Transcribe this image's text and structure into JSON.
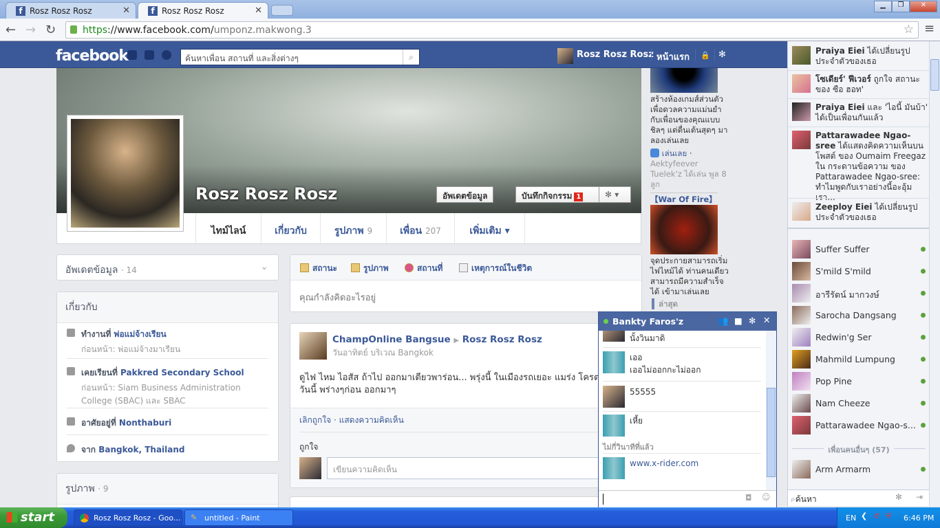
{
  "browser": {
    "tabs": [
      {
        "title": "Rosz Rosz Rosz"
      },
      {
        "title": "Rosz Rosz Rosz"
      }
    ],
    "url_scheme": "https",
    "url_host": "://www.facebook.com/",
    "url_path": "umponz.makwong.3"
  },
  "fb": {
    "logo": "facebook",
    "search_placeholder": "ค้นหาเพื่อน สถานที่ และสิ่งต่างๆ",
    "user_name": "Rosz Rosz Rosz",
    "home": "หน้าแรก"
  },
  "profile": {
    "name": "Rosz Rosz Rosz",
    "update_info": "อัพเดตข้อมูล",
    "activity_log": "บันทึกกิจกรรม",
    "activity_count": "1",
    "tabs": [
      {
        "label": "ไทม์ไลน์",
        "count": ""
      },
      {
        "label": "เกี่ยวกับ",
        "count": ""
      },
      {
        "label": "รูปภาพ",
        "count": "9"
      },
      {
        "label": "เพื่อน",
        "count": "207"
      },
      {
        "label": "เพิ่มเติม ▾",
        "count": ""
      }
    ]
  },
  "left": {
    "updates_label": "อัพเดตข้อมูล",
    "updates_count": "· 14",
    "about_title": "เกี่ยวกับ",
    "about": [
      {
        "prefix": "ทำงานที่ ",
        "link": "พ่อแม่จ้างเรียน",
        "sub": "ก่อนหน้า: พ่อแม่จ้างมาเรียน"
      },
      {
        "prefix": "เคยเรียนที่ ",
        "link": "Pakkred Secondary School",
        "sub": "ก่อนหน้า: Siam Business Administration College (SBAC) และ SBAC"
      },
      {
        "prefix": "อาศัยอยู่ที่ ",
        "link": "Nonthaburi",
        "sub": ""
      },
      {
        "prefix": "จาก ",
        "link": "Bangkok, Thailand",
        "sub": ""
      }
    ],
    "photos_label": "รูปภาพ",
    "photos_count": "· 9"
  },
  "composer": {
    "tabs": [
      "สถานะ",
      "รูปภาพ",
      "สถานที่",
      "เหตุการณ์ในชีวิต"
    ],
    "placeholder": "คุณกำลังคิดอะไรอยู่"
  },
  "post": {
    "author": "ChampOnline Bangsue",
    "target": "Rosz Rosz Rosz",
    "meta": "วันอาทิตย์ บริเวณ Bangkok",
    "text": "ดูไฟ ไหม ไอสัส ถ้าไป ออกมาเตียวพาร่อน... พรุ่งนี้ ในเมืองรถเยอะ แมร่ง โครตติด ไปดูวันนี้ พร่างๆก่อน ออกมาๆ",
    "unlike": "เลิกถูกใจ",
    "comment": "แสดงความคิดเห็น",
    "likes": "ถูกใจ",
    "comment_placeholder": "เขียนความคิดเห็น"
  },
  "ads": {
    "ad1_text": "สร้างห้องเกมส์ส่วนตัว เพื่อดวลความแม่นยำกับเพื่อนของคุณแบบชิลๆ แต่ตื่นเต้นสุดๆ มาลองเล่นเลย",
    "play": "เล่นเลย",
    "ad1_social": "Aektyfeever Tuelek'z ได้เล่น พูล 8 ลูก",
    "ad2_title": "【War Of Fire】",
    "ad2_text": "จุดประกายสามารถเริ่มไฟไหม้ได้ ท่านคนเดียวสามารถมีความสำเร็จได้ เข้ามาเล่นเลย",
    "recent": "ล่าสุด"
  },
  "ticker": [
    {
      "name": "Praiya Eiei",
      "text": " ได้เปลี่ยนรูปประจำตัวของเธอ"
    },
    {
      "name": "โซเดียร์' ฟีเวอร์",
      "text": " ถูกใจ สถานะ ของ ซือ ฮอท'"
    },
    {
      "name": "Praiya Eiei",
      "text": " และ 'ไอนี้ มันบ้า' ได้เป็นเพื่อนกันแล้ว"
    },
    {
      "name": "Pattarawadee Ngao-sree",
      "text": " ได้แสดงคิดความเห็นบนโพสต์ ของ Oumaim Freegaz ใน กระดานข้อความ ของ Pattarawadee Ngao-sree: ทำไมพูดกับเราอย่างนี้อะอุ้มเรา..."
    },
    {
      "name": "Zeeploy Eiei",
      "text": " ได้เปลี่ยนรูปประจำตัวของเธอ"
    }
  ],
  "friends": [
    "Suffer Suffer",
    "S'mild S'mild",
    "อารีรัตน์ มากวงษ์",
    "Sarocha Dangsang",
    "Redwin'g Ser",
    "Mahmild Lumpung",
    "Pop Pine",
    "Nam Cheeze",
    "Pattarawadee Ngao-s..."
  ],
  "more_friends_label": "เพื่อนคนอื่นๆ (57)",
  "more_friends": [
    "Arm Armarm"
  ],
  "chat_search": "ค้นหา",
  "chat": {
    "name": "Bankty Faros'z",
    "messages": [
      {
        "text": "นั้งวินมาดิ",
        "me": true
      },
      {
        "text": "เออ",
        "text2": "เออไม่ออกกะไม่ออก",
        "me": false
      },
      {
        "text": "55555",
        "me": true
      },
      {
        "text": "เหี้ย",
        "me": false
      }
    ],
    "time": "ไม่กี่วินาทีที่แล้ว",
    "link": "www.x-rider.com"
  },
  "taskbar": {
    "start": "start",
    "items": [
      "Rosz Rosz Rosz - Goo...",
      "untitled - Paint"
    ],
    "lang": "EN",
    "clock": "6:46 PM"
  }
}
